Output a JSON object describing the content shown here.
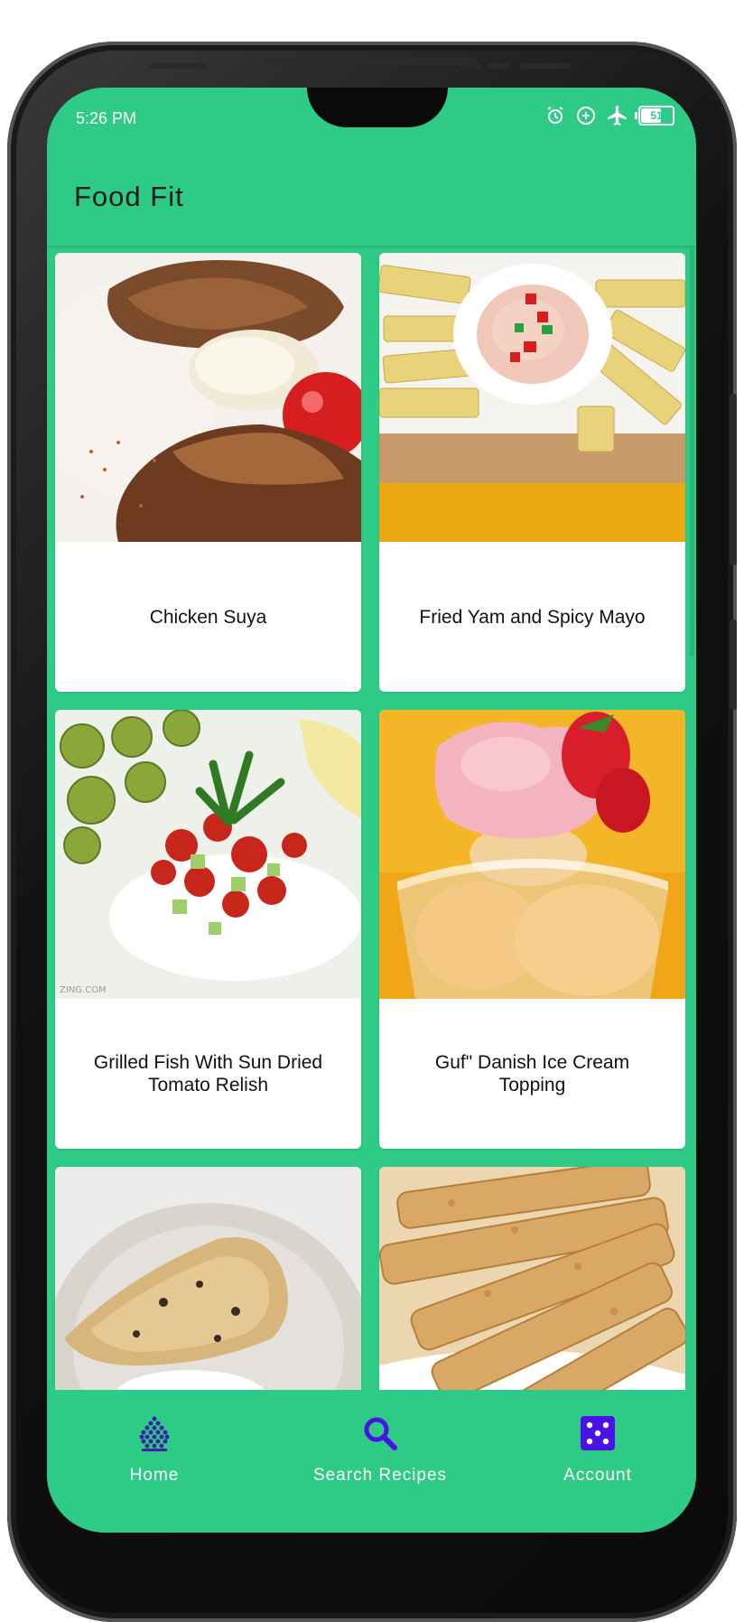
{
  "status_bar": {
    "time": "5:26 PM",
    "icons": [
      "alarm-icon",
      "data-saver-icon",
      "airplane-icon",
      "battery-icon"
    ],
    "battery_level": "51"
  },
  "app_bar": {
    "title": "Food Fit"
  },
  "recipes": [
    {
      "title": "Chicken Suya",
      "image": "chicken-suya-photo"
    },
    {
      "title": "Fried Yam and Spicy Mayo",
      "image": "fried-yam-photo"
    },
    {
      "title": "Grilled Fish With Sun Dried Tomato Relish",
      "image": "grilled-fish-photo"
    },
    {
      "title": "Guf\" Danish Ice Cream Topping",
      "image": "ice-cream-photo"
    },
    {
      "title": "",
      "image": "scone-photo"
    },
    {
      "title": "",
      "image": "biscotti-photo"
    }
  ],
  "bottom_nav": {
    "items": [
      {
        "label": "Home",
        "icon": "home-icon"
      },
      {
        "label": "Search Recipes",
        "icon": "search-icon"
      },
      {
        "label": "Account",
        "icon": "account-icon"
      }
    ]
  },
  "colors": {
    "primary": "#2dcb85",
    "nav_icon_active": "#4a12e6",
    "card": "#ffffff"
  }
}
